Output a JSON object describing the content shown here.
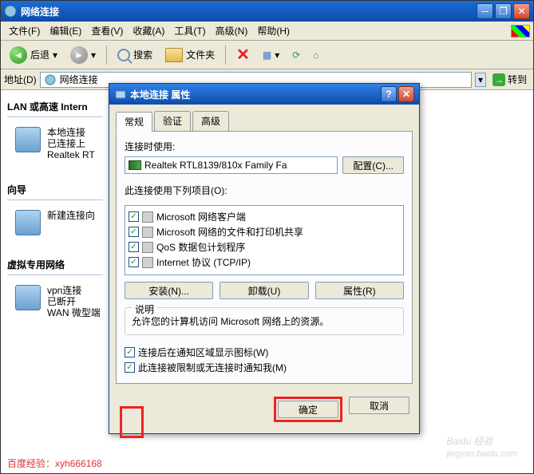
{
  "window": {
    "title": "网络连接",
    "menus": [
      "文件(F)",
      "编辑(E)",
      "查看(V)",
      "收藏(A)",
      "工具(T)",
      "高级(N)",
      "帮助(H)"
    ],
    "toolbar": {
      "back": "后退",
      "search": "搜索",
      "folders": "文件夹"
    },
    "address": {
      "label": "地址(D)",
      "value": "网络连接",
      "go": "转到"
    }
  },
  "groups": {
    "lan": {
      "header": "LAN 或高速 Intern",
      "item": {
        "name": "本地连接",
        "status": "已连接上",
        "device": "Realtek RT"
      }
    },
    "wizard": {
      "header": "向导",
      "item": {
        "name": "新建连接向"
      }
    },
    "virtual": {
      "header": "虚拟专用网络",
      "item": {
        "name": "vpn连接",
        "status": "已断开",
        "device": "WAN 微型端"
      }
    }
  },
  "dialog": {
    "title": "本地连接 属性",
    "tabs": [
      "常规",
      "验证",
      "高级"
    ],
    "connect_using": "连接时使用:",
    "nic": "Realtek RTL8139/810x Family Fa",
    "configure": "配置(C)...",
    "items_label": "此连接使用下列项目(O):",
    "items": [
      {
        "checked": true,
        "label": "Microsoft 网络客户端"
      },
      {
        "checked": true,
        "label": "Microsoft 网络的文件和打印机共享"
      },
      {
        "checked": true,
        "label": "QoS 数据包计划程序"
      },
      {
        "checked": true,
        "label": "Internet 协议 (TCP/IP)"
      }
    ],
    "install": "安装(N)...",
    "uninstall": "卸载(U)",
    "properties": "属性(R)",
    "desc_title": "说明",
    "desc_text": "允许您的计算机访问 Microsoft 网络上的资源。",
    "chk_notify": "连接后在通知区域显示图标(W)",
    "chk_limited": "此连接被限制或无连接时通知我(M)",
    "ok": "确定",
    "cancel": "取消"
  },
  "footer": "百度经验：xyh666168",
  "watermark": {
    "main": "Baidu 经验",
    "sub": "jingyan.baidu.com"
  }
}
